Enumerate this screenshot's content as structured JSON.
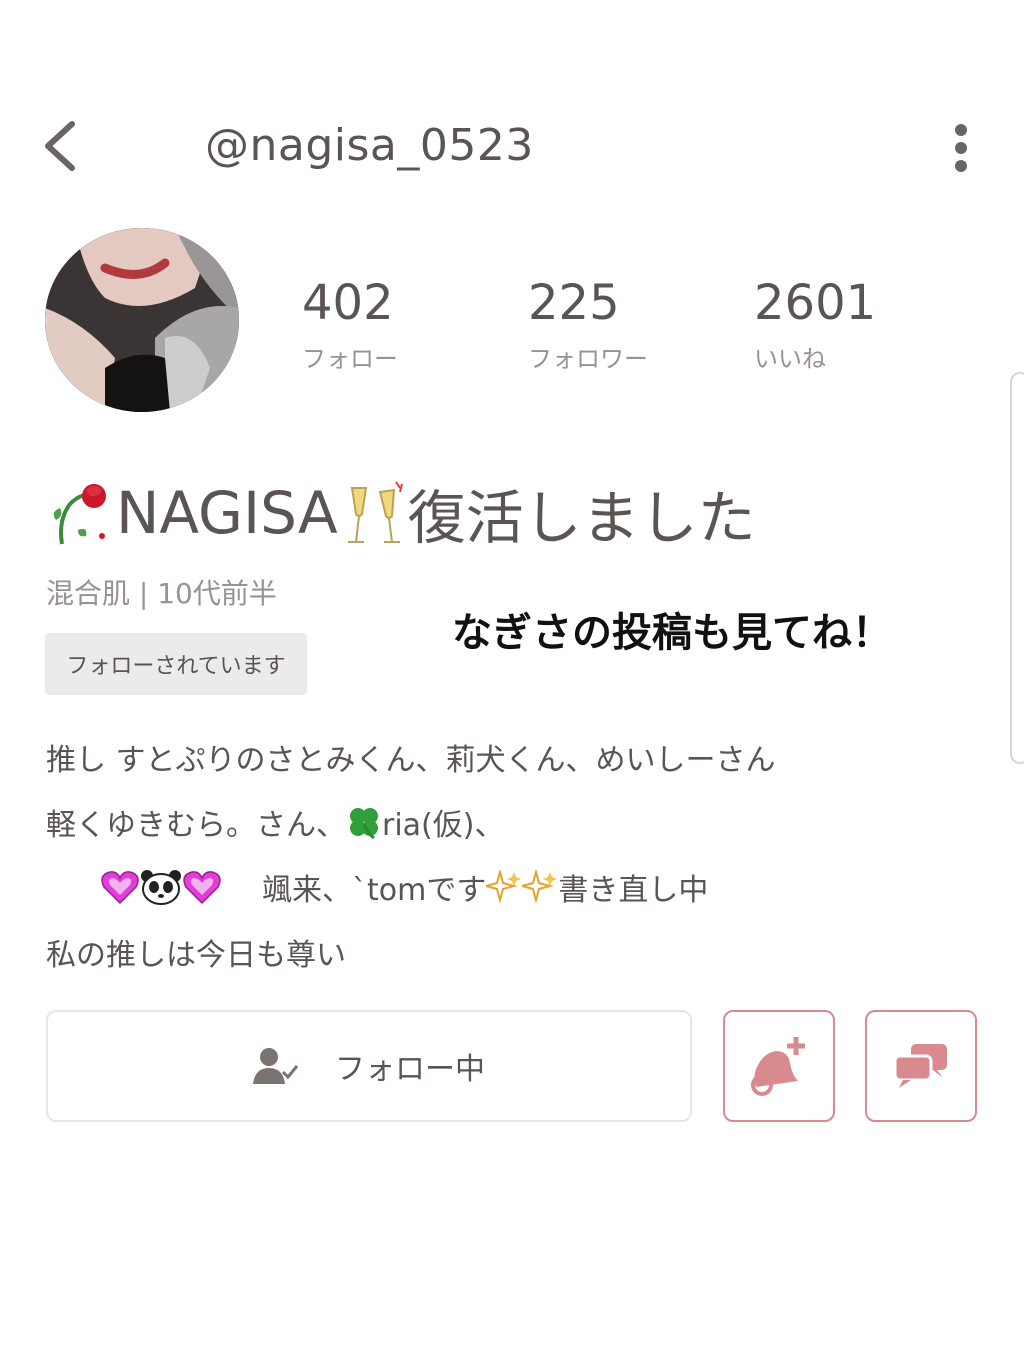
{
  "header": {
    "handle": "@nagisa_0523"
  },
  "stats": [
    {
      "value": "402",
      "label": "フォロー"
    },
    {
      "value": "225",
      "label": "フォロワー"
    },
    {
      "value": "2601",
      "label": "いいね"
    }
  ],
  "profile": {
    "name": "NAGISA",
    "name_suffix": "復活しました",
    "skin_age": "混合肌 | 10代前半",
    "follows_you_badge": "フォローされています",
    "overlay_note": "なぎさの投稿も見てね！"
  },
  "bio": {
    "line1": "推し  すとぷりのさとみくん、莉犬くん、めいしーさん",
    "line2a": "軽くゆきむら。さん、",
    "line2b": "ria(仮)、",
    "line3a": "颯来、`tomです",
    "line3b": "書き直し中",
    "line4": "私の推しは今日も尊い"
  },
  "actions": {
    "follow_label": "フォロー中"
  },
  "colors": {
    "accent": "#d98a8f",
    "text": "#5a5453",
    "muted": "#9a9290",
    "badge_bg": "#ecebe9"
  },
  "icons": [
    "back-chevron-icon",
    "more-vertical-icon",
    "wilted-rose-icon",
    "champagne-icon",
    "clover-icon",
    "heart-icon",
    "panda-icon",
    "sparkle-icon",
    "user-check-icon",
    "bell-plus-icon",
    "chat-bubbles-icon"
  ]
}
